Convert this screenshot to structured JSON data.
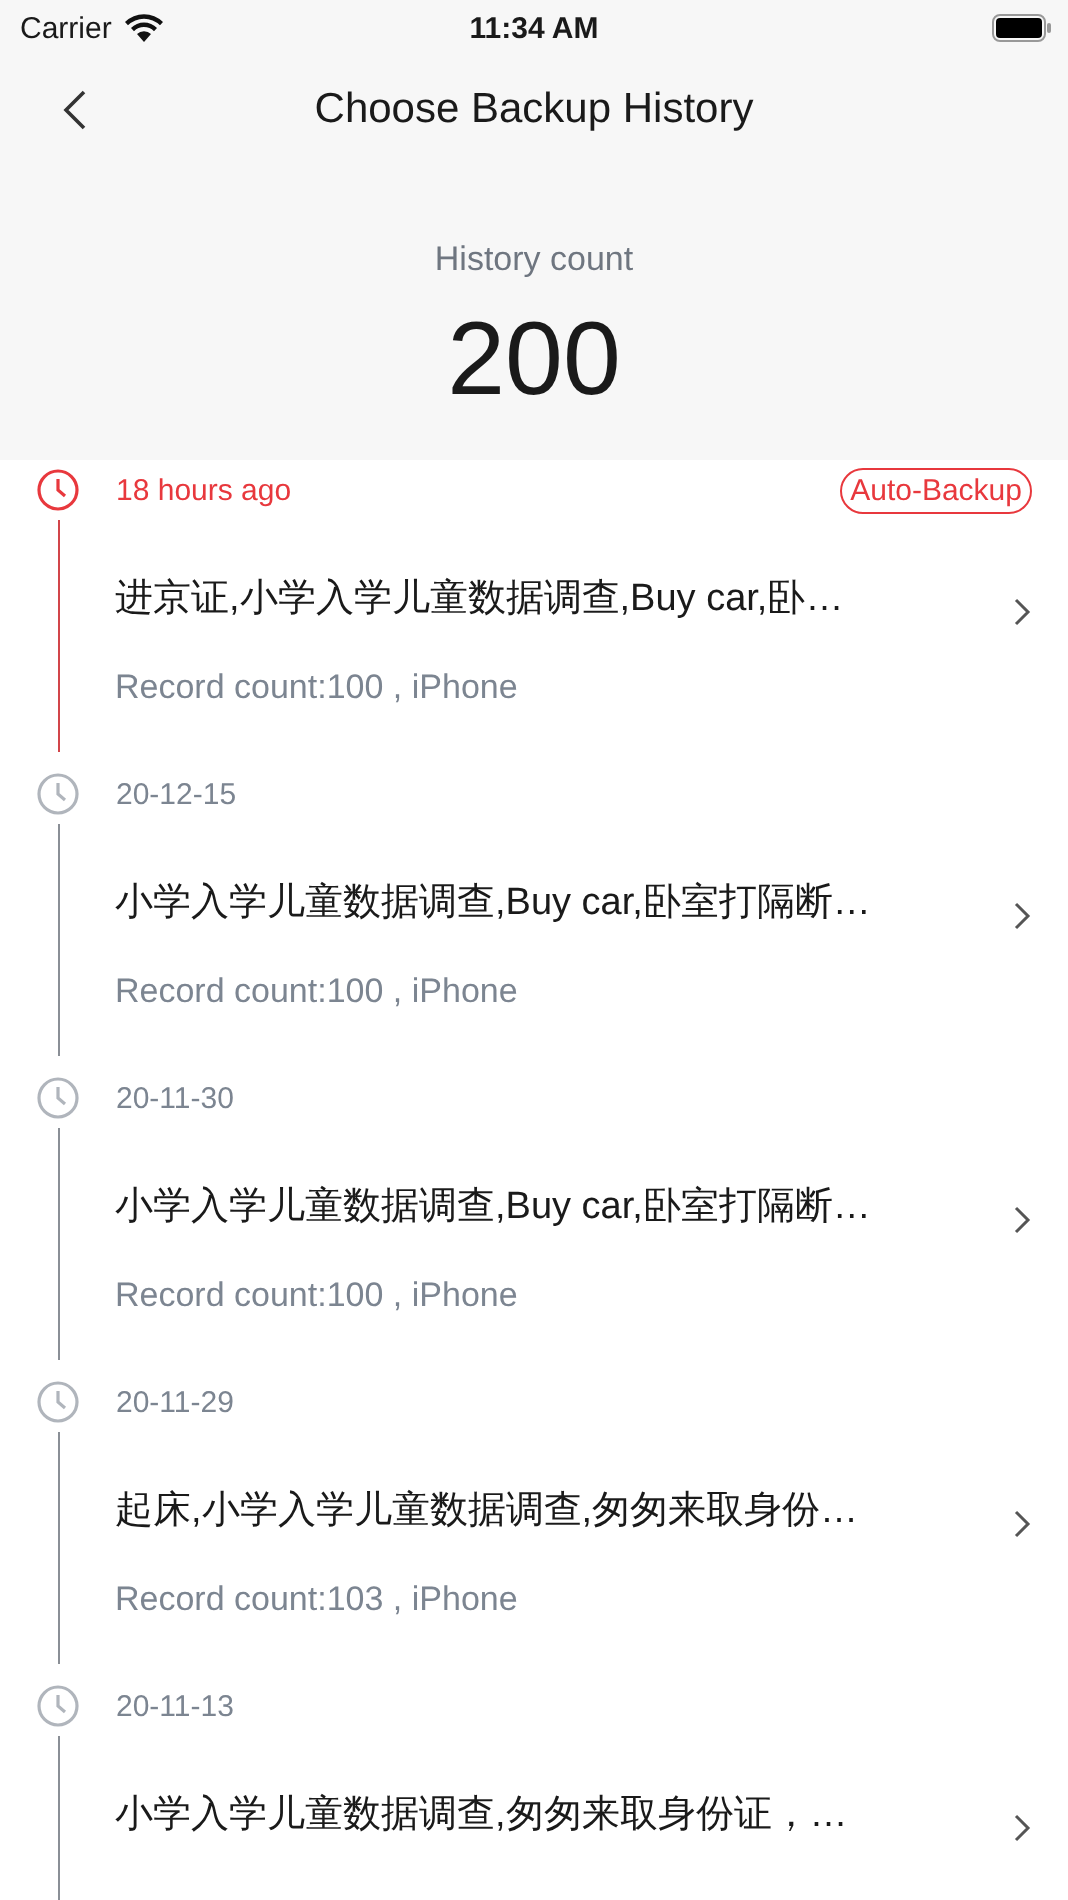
{
  "status_bar": {
    "carrier": "Carrier",
    "time": "11:34 AM"
  },
  "nav": {
    "title": "Choose Backup History"
  },
  "summary": {
    "label": "History count",
    "count": "200"
  },
  "entries": [
    {
      "date": "18 hours ago",
      "highlighted": true,
      "badge": "Auto-Backup",
      "title": "进京证,小学入学儿童数据调查,Buy car,卧…",
      "subtitle": "Record count:100 , iPhone"
    },
    {
      "date": "20-12-15",
      "highlighted": false,
      "title": "小学入学儿童数据调查,Buy car,卧室打隔断…",
      "subtitle": "Record count:100 , iPhone"
    },
    {
      "date": "20-11-30",
      "highlighted": false,
      "title": "小学入学儿童数据调查,Buy car,卧室打隔断…",
      "subtitle": "Record count:100 , iPhone"
    },
    {
      "date": "20-11-29",
      "highlighted": false,
      "title": "起床,小学入学儿童数据调查,匆匆来取身份…",
      "subtitle": "Record count:103 , iPhone"
    },
    {
      "date": "20-11-13",
      "highlighted": false,
      "title": "小学入学儿童数据调查,匆匆来取身份证，…"
    }
  ]
}
